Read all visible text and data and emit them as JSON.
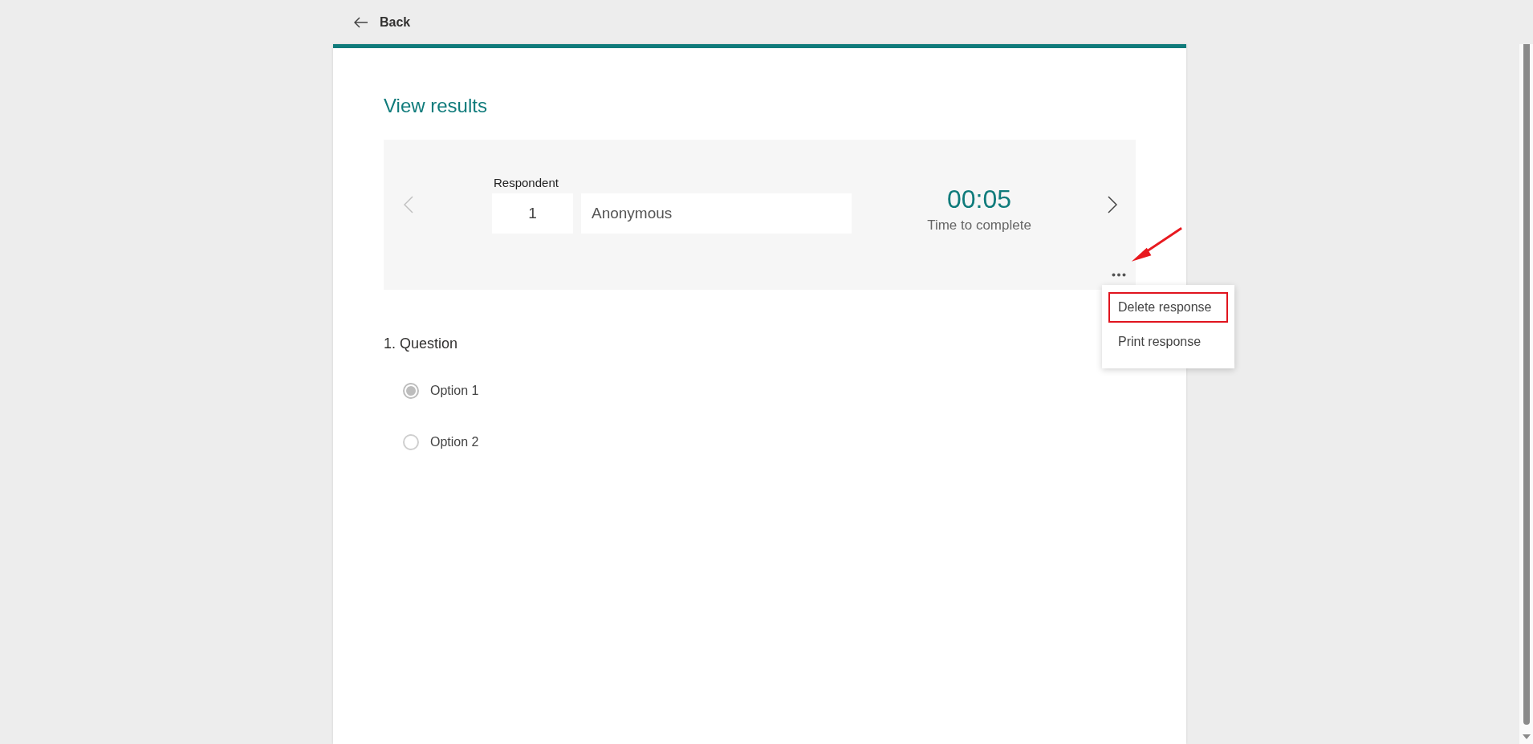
{
  "back_link": {
    "label": "Back"
  },
  "title": "View results",
  "respondent": {
    "label": "Respondent",
    "number": "1",
    "name": "Anonymous"
  },
  "time": {
    "value": "00:05",
    "label": "Time to complete"
  },
  "navigation": {
    "previous_disabled": true,
    "next_disabled": false
  },
  "more_menu": {
    "open": true,
    "items": [
      {
        "label": "Delete response",
        "highlighted": true
      },
      {
        "label": "Print response",
        "highlighted": false
      }
    ]
  },
  "question": {
    "title": "1. Question",
    "options": [
      {
        "label": "Option 1",
        "selected": true
      },
      {
        "label": "Option 2",
        "selected": false
      }
    ]
  }
}
